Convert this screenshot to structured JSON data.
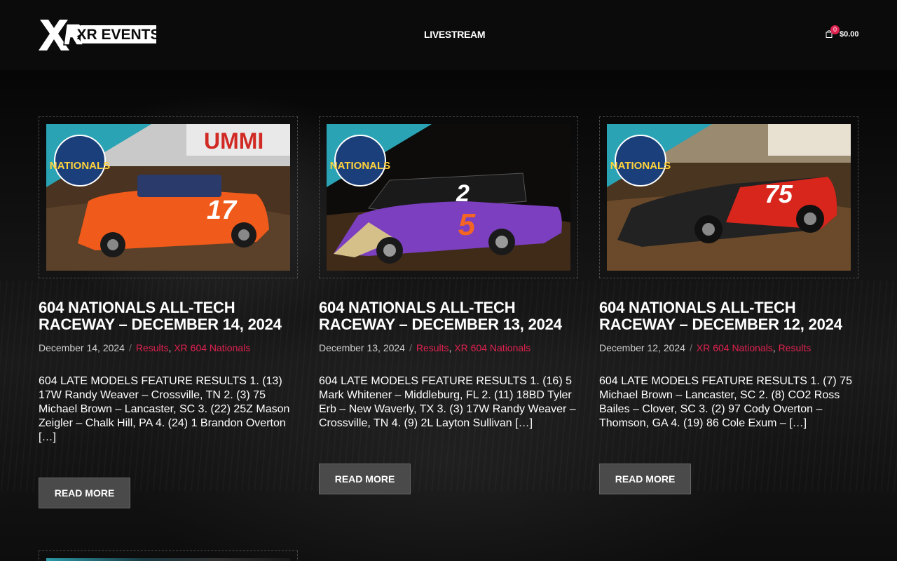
{
  "header": {
    "logo_text": "XR EVENTS",
    "nav_livestream": "LIVESTREAM",
    "cart_count": "0",
    "cart_total": "$0.00"
  },
  "posts": [
    {
      "title": "604 NATIONALS ALL-TECH RACEWAY – DECEMBER 14, 2024",
      "date": "December 14, 2024",
      "categories": [
        "Results",
        "XR 604 Nationals"
      ],
      "excerpt": "604 LATE MODELS FEATURE RESULTS 1. (13) 17W Randy Weaver – Crossville, TN 2. (3) 75 Michael Brown – Lancaster, SC 3. (22) 25Z Mason Zeigler – Chalk Hill, PA 4. (24) 1 Brandon Overton […]",
      "read_more": "READ MORE",
      "car_number": "17",
      "car_color": "#f05a1a",
      "image_badge": "NATIONALS"
    },
    {
      "title": "604 NATIONALS ALL-TECH RACEWAY – DECEMBER 13, 2024",
      "date": "December 13, 2024",
      "categories": [
        "Results",
        "XR 604 Nationals"
      ],
      "excerpt": "604 LATE MODELS FEATURE RESULTS 1. (16) 5 Mark Whitener – Middleburg, FL 2. (11) 18BD Tyler Erb – New Waverly, TX 3. (3) 17W Randy Weaver – Crossville, TN 4. (9) 2L Layton Sullivan […]",
      "read_more": "READ MORE",
      "car_number": "5",
      "car_color": "#7b3fbf",
      "image_badge": "NATIONALS"
    },
    {
      "title": "604 NATIONALS ALL-TECH RACEWAY – DECEMBER 12, 2024",
      "date": "December 12, 2024",
      "categories": [
        "XR 604 Nationals",
        "Results"
      ],
      "excerpt": "604 LATE MODELS FEATURE RESULTS 1. (7) 75 Michael Brown – Lancaster, SC 2. (8) CO2 Ross Bailes – Clover, SC 3. (2) 97 Cody Overton – Thomson, GA 4. (19) 86 Cole Exum – […]",
      "read_more": "READ MORE",
      "car_number": "75",
      "car_color": "#d8261c",
      "image_badge": "NATIONALS"
    }
  ],
  "colors": {
    "accent": "#e0204f",
    "button_bg": "#4a4a4a",
    "background": "#0b0b0b"
  }
}
